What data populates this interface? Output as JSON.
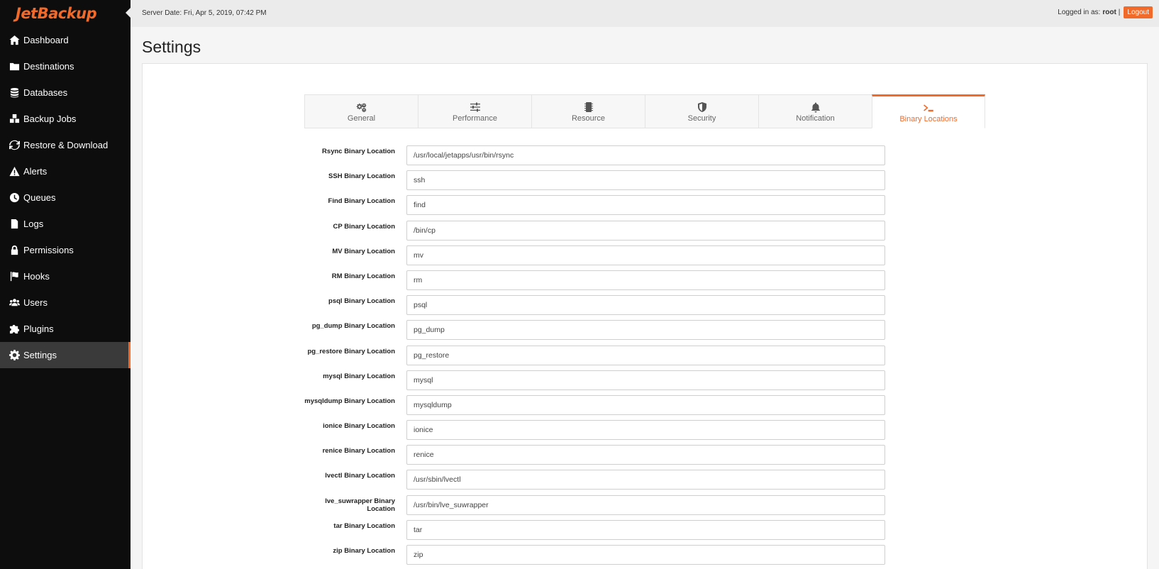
{
  "brand": {
    "logo_text": "JetBackup",
    "accent": "#f26a2a"
  },
  "header": {
    "server_date": "Server Date: Fri, Apr 5, 2019, 07:42 PM",
    "logged_prefix": "Logged in as:",
    "user": "root",
    "separator": "|",
    "logout_label": "Logout"
  },
  "sidebar": {
    "items": [
      {
        "label": "Dashboard",
        "icon": "home-icon"
      },
      {
        "label": "Destinations",
        "icon": "folder-icon"
      },
      {
        "label": "Databases",
        "icon": "database-icon"
      },
      {
        "label": "Backup Jobs",
        "icon": "cubes-icon"
      },
      {
        "label": "Restore & Download",
        "icon": "refresh-icon"
      },
      {
        "label": "Alerts",
        "icon": "warning-icon"
      },
      {
        "label": "Queues",
        "icon": "clock-icon"
      },
      {
        "label": "Logs",
        "icon": "file-icon"
      },
      {
        "label": "Permissions",
        "icon": "lock-icon"
      },
      {
        "label": "Hooks",
        "icon": "flag-icon"
      },
      {
        "label": "Users",
        "icon": "users-icon"
      },
      {
        "label": "Plugins",
        "icon": "puzzle-icon"
      },
      {
        "label": "Settings",
        "icon": "gear-icon",
        "active": true
      }
    ]
  },
  "page": {
    "title": "Settings"
  },
  "tabs": [
    {
      "label": "General",
      "icon": "gears-icon"
    },
    {
      "label": "Performance",
      "icon": "sliders-icon"
    },
    {
      "label": "Resource",
      "icon": "chip-icon"
    },
    {
      "label": "Security",
      "icon": "shield-icon"
    },
    {
      "label": "Notification",
      "icon": "bell-icon"
    },
    {
      "label": "Binary Locations",
      "icon": "terminal-icon",
      "active": true
    }
  ],
  "fields": [
    {
      "label": "Rsync Binary Location",
      "value": "/usr/local/jetapps/usr/bin/rsync"
    },
    {
      "label": "SSH Binary Location",
      "value": "ssh"
    },
    {
      "label": "Find Binary Location",
      "value": "find"
    },
    {
      "label": "CP Binary Location",
      "value": "/bin/cp"
    },
    {
      "label": "MV Binary Location",
      "value": "mv"
    },
    {
      "label": "RM Binary Location",
      "value": "rm"
    },
    {
      "label": "psql Binary Location",
      "value": "psql"
    },
    {
      "label": "pg_dump Binary Location",
      "value": "pg_dump"
    },
    {
      "label": "pg_restore Binary Location",
      "value": "pg_restore"
    },
    {
      "label": "mysql Binary Location",
      "value": "mysql"
    },
    {
      "label": "mysqldump Binary Location",
      "value": "mysqldump"
    },
    {
      "label": "ionice Binary Location",
      "value": "ionice"
    },
    {
      "label": "renice Binary Location",
      "value": "renice"
    },
    {
      "label": "lvectl Binary Location",
      "value": "/usr/sbin/lvectl"
    },
    {
      "label": "lve_suwrapper Binary Location",
      "value": "/usr/bin/lve_suwrapper"
    },
    {
      "label": "tar Binary Location",
      "value": "tar"
    },
    {
      "label": "zip Binary Location",
      "value": "zip"
    }
  ]
}
